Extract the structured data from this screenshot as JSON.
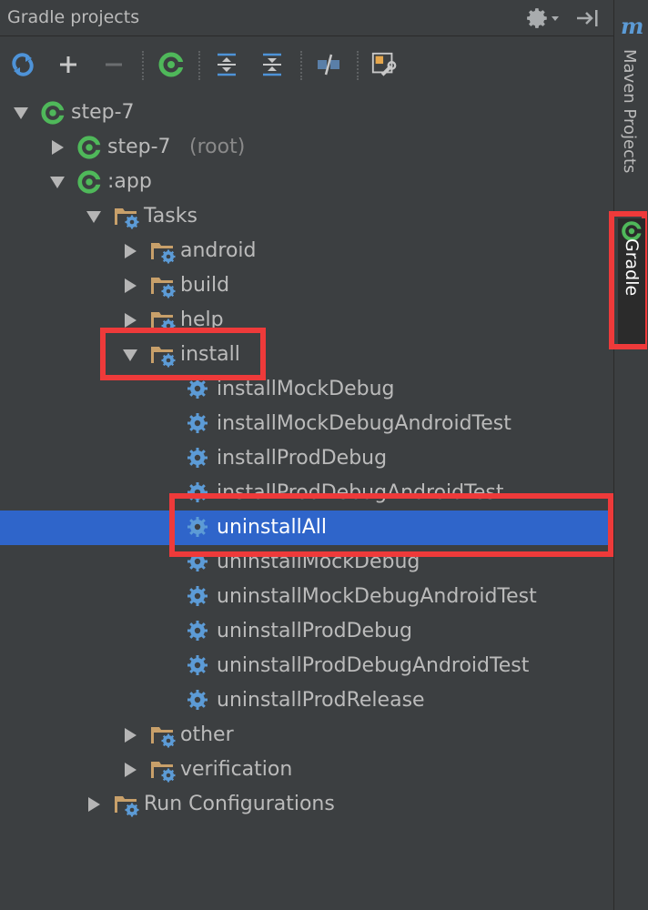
{
  "panel": {
    "title": "Gradle projects",
    "toolbar": {
      "icons": [
        "refresh-icon",
        "add-icon",
        "remove-icon",
        "gradle-task-icon",
        "expand-all-icon",
        "collapse-all-icon",
        "toggle-offline-icon",
        "settings-wrench-icon"
      ]
    }
  },
  "tree": {
    "rows": [
      {
        "label": "step-7",
        "suffix": "",
        "icon": "gradle-icon",
        "expanded": true,
        "depth": 0
      },
      {
        "label": "step-7",
        "suffix": "(root)",
        "icon": "gradle-icon",
        "expanded": false,
        "depth": 1
      },
      {
        "label": ":app",
        "suffix": "",
        "icon": "gradle-icon",
        "expanded": true,
        "depth": 1
      },
      {
        "label": "Tasks",
        "suffix": "",
        "icon": "task-folder-icon",
        "expanded": true,
        "depth": 2
      },
      {
        "label": "android",
        "suffix": "",
        "icon": "task-folder-icon",
        "expanded": false,
        "depth": 3
      },
      {
        "label": "build",
        "suffix": "",
        "icon": "task-folder-icon",
        "expanded": false,
        "depth": 3
      },
      {
        "label": "help",
        "suffix": "",
        "icon": "task-folder-icon",
        "expanded": false,
        "depth": 3
      },
      {
        "label": "install",
        "suffix": "",
        "icon": "task-folder-icon",
        "expanded": true,
        "depth": 3
      },
      {
        "label": "installMockDebug",
        "suffix": "",
        "icon": "task-gear-icon",
        "depth": 4
      },
      {
        "label": "installMockDebugAndroidTest",
        "suffix": "",
        "icon": "task-gear-icon",
        "depth": 4
      },
      {
        "label": "installProdDebug",
        "suffix": "",
        "icon": "task-gear-icon",
        "depth": 4
      },
      {
        "label": "installProdDebugAndroidTest",
        "suffix": "",
        "icon": "task-gear-icon",
        "depth": 4
      },
      {
        "label": "uninstallAll",
        "suffix": "",
        "icon": "task-gear-icon",
        "depth": 4,
        "selected": true
      },
      {
        "label": "uninstallMockDebug",
        "suffix": "",
        "icon": "task-gear-icon",
        "depth": 4
      },
      {
        "label": "uninstallMockDebugAndroidTest",
        "suffix": "",
        "icon": "task-gear-icon",
        "depth": 4
      },
      {
        "label": "uninstallProdDebug",
        "suffix": "",
        "icon": "task-gear-icon",
        "depth": 4
      },
      {
        "label": "uninstallProdDebugAndroidTest",
        "suffix": "",
        "icon": "task-gear-icon",
        "depth": 4
      },
      {
        "label": "uninstallProdRelease",
        "suffix": "",
        "icon": "task-gear-icon",
        "depth": 4
      },
      {
        "label": "other",
        "suffix": "",
        "icon": "task-folder-icon",
        "expanded": false,
        "depth": 3
      },
      {
        "label": "verification",
        "suffix": "",
        "icon": "task-folder-icon",
        "expanded": false,
        "depth": 3
      },
      {
        "label": "Run Configurations",
        "suffix": "",
        "icon": "task-folder-icon",
        "expanded": false,
        "depth": 2
      }
    ]
  },
  "side_tabs": {
    "maven_logo": "m",
    "maven": "Maven Projects",
    "gradle": "Gradle"
  },
  "colors": {
    "background": "#3c3f41",
    "selection": "#2f65ca",
    "highlight": "#ee3a3a",
    "gradle_green": "#4fb85a",
    "gear_blue": "#5c9bd6",
    "folder": "#c8a06a"
  }
}
